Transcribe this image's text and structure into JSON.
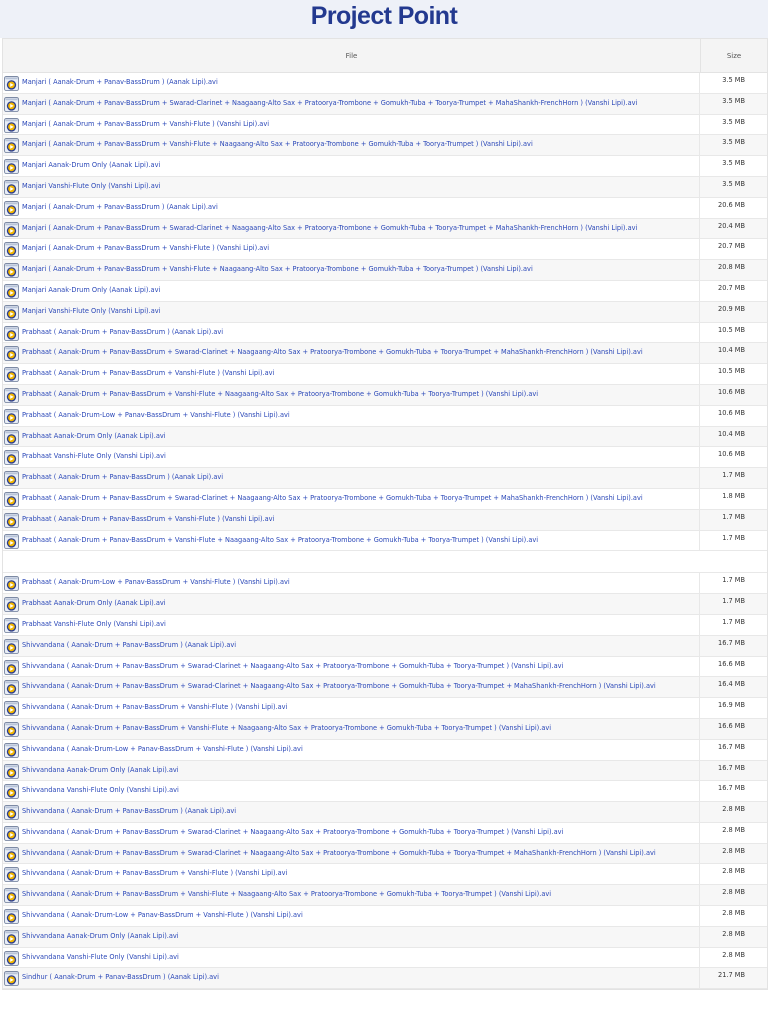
{
  "header": {
    "title": "Project Point"
  },
  "columns": {
    "file": "File",
    "size": "Size"
  },
  "files": [
    {
      "name": "Manjari ( Aanak-Drum + Panav-BassDrum ) (Aanak Lipi).avi",
      "size": "3.5 MB"
    },
    {
      "name": "Manjari ( Aanak-Drum + Panav-BassDrum + Swarad-Clarinet + Naagaang-Alto Sax + Pratoorya-Trombone + Gomukh-Tuba + Toorya-Trumpet + MahaShankh-FrenchHorn ) (Vanshi Lipi).avi",
      "size": "3.5 MB"
    },
    {
      "name": "Manjari ( Aanak-Drum + Panav-BassDrum + Vanshi-Flute ) (Vanshi Lipi).avi",
      "size": "3.5 MB"
    },
    {
      "name": "Manjari ( Aanak-Drum + Panav-BassDrum + Vanshi-Flute + Naagaang-Alto Sax + Pratoorya-Trombone + Gomukh-Tuba + Toorya-Trumpet ) (Vanshi Lipi).avi",
      "size": "3.5 MB"
    },
    {
      "name": "Manjari Aanak-Drum Only (Aanak Lipi).avi",
      "size": "3.5 MB"
    },
    {
      "name": "Manjari Vanshi-Flute Only (Vanshi Lipi).avi",
      "size": "3.5 MB"
    },
    {
      "name": "Manjari ( Aanak-Drum + Panav-BassDrum ) (Aanak Lipi).avi",
      "size": "20.6 MB"
    },
    {
      "name": "Manjari ( Aanak-Drum + Panav-BassDrum + Swarad-Clarinet + Naagaang-Alto Sax + Pratoorya-Trombone + Gomukh-Tuba + Toorya-Trumpet + MahaShankh-FrenchHorn ) (Vanshi Lipi).avi",
      "size": "20.4 MB"
    },
    {
      "name": "Manjari ( Aanak-Drum + Panav-BassDrum + Vanshi-Flute ) (Vanshi Lipi).avi",
      "size": "20.7 MB"
    },
    {
      "name": "Manjari ( Aanak-Drum + Panav-BassDrum + Vanshi-Flute + Naagaang-Alto Sax + Pratoorya-Trombone + Gomukh-Tuba + Toorya-Trumpet ) (Vanshi Lipi).avi",
      "size": "20.8 MB"
    },
    {
      "name": "Manjari Aanak-Drum Only (Aanak Lipi).avi",
      "size": "20.7 MB"
    },
    {
      "name": "Manjari Vanshi-Flute Only (Vanshi Lipi).avi",
      "size": "20.9 MB"
    },
    {
      "name": "Prabhaat ( Aanak-Drum + Panav-BassDrum ) (Aanak Lipi).avi",
      "size": "10.5 MB"
    },
    {
      "name": "Prabhaat ( Aanak-Drum + Panav-BassDrum + Swarad-Clarinet + Naagaang-Alto Sax + Pratoorya-Trombone + Gomukh-Tuba + Toorya-Trumpet + MahaShankh-FrenchHorn ) (Vanshi Lipi).avi",
      "size": "10.4 MB"
    },
    {
      "name": "Prabhaat ( Aanak-Drum + Panav-BassDrum + Vanshi-Flute ) (Vanshi Lipi).avi",
      "size": "10.5 MB"
    },
    {
      "name": "Prabhaat ( Aanak-Drum + Panav-BassDrum + Vanshi-Flute + Naagaang-Alto Sax + Pratoorya-Trombone + Gomukh-Tuba + Toorya-Trumpet ) (Vanshi Lipi).avi",
      "size": "10.6 MB"
    },
    {
      "name": "Prabhaat ( Aanak-Drum-Low + Panav-BassDrum + Vanshi-Flute ) (Vanshi Lipi).avi",
      "size": "10.6 MB"
    },
    {
      "name": "Prabhaat Aanak-Drum Only (Aanak Lipi).avi",
      "size": "10.4 MB"
    },
    {
      "name": "Prabhaat Vanshi-Flute Only (Vanshi Lipi).avi",
      "size": "10.6 MB"
    },
    {
      "name": "Prabhaat ( Aanak-Drum + Panav-BassDrum ) (Aanak Lipi).avi",
      "size": "1.7 MB"
    },
    {
      "name": "Prabhaat ( Aanak-Drum + Panav-BassDrum + Swarad-Clarinet + Naagaang-Alto Sax + Pratoorya-Trombone + Gomukh-Tuba + Toorya-Trumpet + MahaShankh-FrenchHorn ) (Vanshi Lipi).avi",
      "size": "1.8 MB"
    },
    {
      "name": "Prabhaat ( Aanak-Drum + Panav-BassDrum + Vanshi-Flute ) (Vanshi Lipi).avi",
      "size": "1.7 MB"
    },
    {
      "name": "Prabhaat ( Aanak-Drum + Panav-BassDrum + Vanshi-Flute + Naagaang-Alto Sax + Pratoorya-Trombone + Gomukh-Tuba + Toorya-Trumpet ) (Vanshi Lipi).avi",
      "size": "1.7 MB"
    },
    {
      "name": "Prabhaat ( Aanak-Drum-Low + Panav-BassDrum + Vanshi-Flute ) (Vanshi Lipi).avi",
      "size": "1.7 MB"
    },
    {
      "name": "Prabhaat Aanak-Drum Only (Aanak Lipi).avi",
      "size": "1.7 MB"
    },
    {
      "name": "Prabhaat Vanshi-Flute Only (Vanshi Lipi).avi",
      "size": "1.7 MB"
    },
    {
      "name": "Shivvandana ( Aanak-Drum + Panav-BassDrum ) (Aanak Lipi).avi",
      "size": "16.7 MB"
    },
    {
      "name": "Shivvandana ( Aanak-Drum + Panav-BassDrum + Swarad-Clarinet + Naagaang-Alto Sax + Pratoorya-Trombone + Gomukh-Tuba + Toorya-Trumpet ) (Vanshi Lipi).avi",
      "size": "16.6 MB"
    },
    {
      "name": "Shivvandana ( Aanak-Drum + Panav-BassDrum + Swarad-Clarinet + Naagaang-Alto Sax + Pratoorya-Trombone + Gomukh-Tuba + Toorya-Trumpet + MahaShankh-FrenchHorn ) (Vanshi Lipi).avi",
      "size": "16.4 MB"
    },
    {
      "name": "Shivvandana ( Aanak-Drum + Panav-BassDrum + Vanshi-Flute ) (Vanshi Lipi).avi",
      "size": "16.9 MB"
    },
    {
      "name": "Shivvandana ( Aanak-Drum + Panav-BassDrum + Vanshi-Flute + Naagaang-Alto Sax + Pratoorya-Trombone + Gomukh-Tuba + Toorya-Trumpet ) (Vanshi Lipi).avi",
      "size": "16.6 MB"
    },
    {
      "name": "Shivvandana ( Aanak-Drum-Low + Panav-BassDrum + Vanshi-Flute ) (Vanshi Lipi).avi",
      "size": "16.7 MB"
    },
    {
      "name": "Shivvandana Aanak-Drum Only (Aanak Lipi).avi",
      "size": "16.7 MB"
    },
    {
      "name": "Shivvandana Vanshi-Flute Only (Vanshi Lipi).avi",
      "size": "16.7 MB"
    },
    {
      "name": "Shivvandana ( Aanak-Drum + Panav-BassDrum ) (Aanak Lipi).avi",
      "size": "2.8 MB"
    },
    {
      "name": "Shivvandana ( Aanak-Drum + Panav-BassDrum + Swarad-Clarinet + Naagaang-Alto Sax + Pratoorya-Trombone + Gomukh-Tuba + Toorya-Trumpet ) (Vanshi Lipi).avi",
      "size": "2.8 MB"
    },
    {
      "name": "Shivvandana ( Aanak-Drum + Panav-BassDrum + Swarad-Clarinet + Naagaang-Alto Sax + Pratoorya-Trombone + Gomukh-Tuba + Toorya-Trumpet + MahaShankh-FrenchHorn ) (Vanshi Lipi).avi",
      "size": "2.8 MB"
    },
    {
      "name": "Shivvandana ( Aanak-Drum + Panav-BassDrum + Vanshi-Flute ) (Vanshi Lipi).avi",
      "size": "2.8 MB"
    },
    {
      "name": "Shivvandana ( Aanak-Drum + Panav-BassDrum + Vanshi-Flute + Naagaang-Alto Sax + Pratoorya-Trombone + Gomukh-Tuba + Toorya-Trumpet ) (Vanshi Lipi).avi",
      "size": "2.8 MB"
    },
    {
      "name": "Shivvandana ( Aanak-Drum-Low + Panav-BassDrum + Vanshi-Flute ) (Vanshi Lipi).avi",
      "size": "2.8 MB"
    },
    {
      "name": "Shivvandana Aanak-Drum Only (Aanak Lipi).avi",
      "size": "2.8 MB"
    },
    {
      "name": "Shivvandana Vanshi-Flute Only (Vanshi Lipi).avi",
      "size": "2.8 MB"
    },
    {
      "name": "Sindhur ( Aanak-Drum + Panav-BassDrum ) (Aanak Lipi).avi",
      "size": "21.7 MB"
    }
  ],
  "icon": "video-file-icon",
  "colors": {
    "title": "#23398f",
    "link": "#2b48b8",
    "header_bg": "#eef1f8"
  }
}
